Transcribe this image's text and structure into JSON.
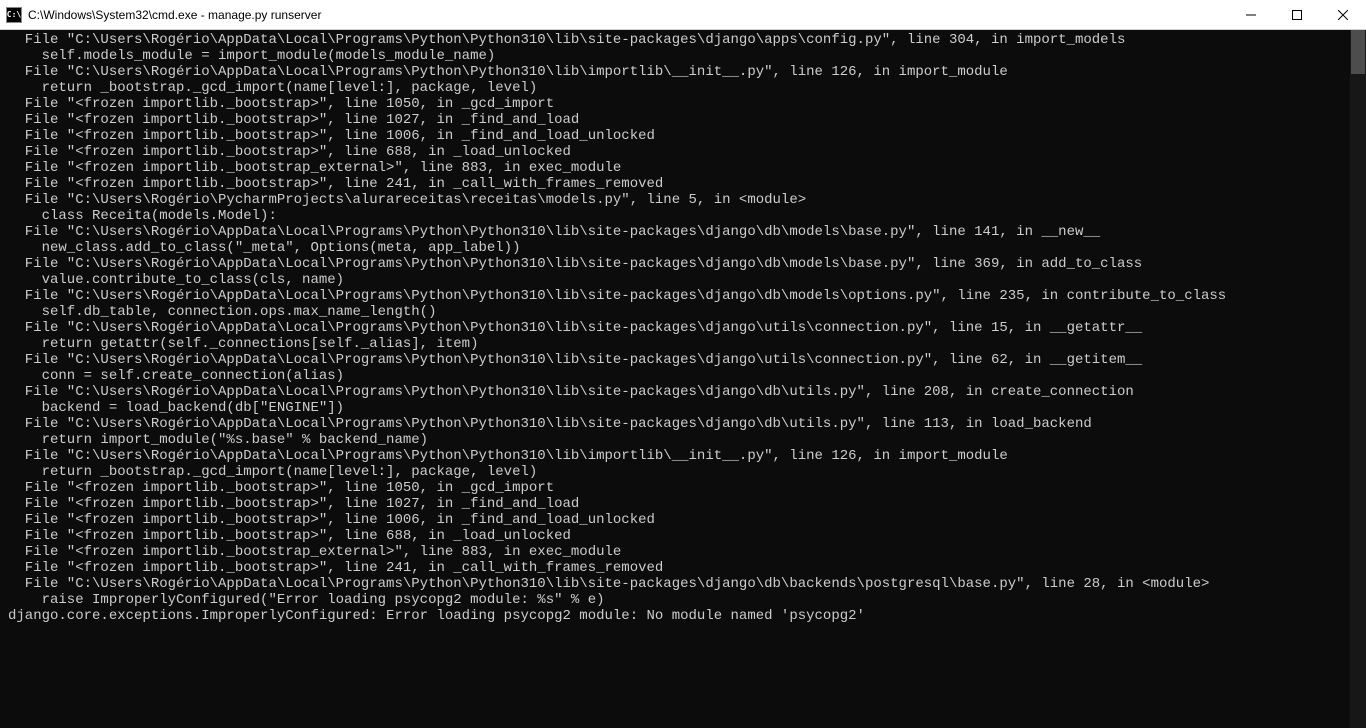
{
  "window": {
    "title": "C:\\Windows\\System32\\cmd.exe - manage.py  runserver",
    "icon_label": "C:\\"
  },
  "terminal": {
    "lines": [
      "  File \"C:\\Users\\Rogério\\AppData\\Local\\Programs\\Python\\Python310\\lib\\site-packages\\django\\apps\\config.py\", line 304, in import_models",
      "    self.models_module = import_module(models_module_name)",
      "  File \"C:\\Users\\Rogério\\AppData\\Local\\Programs\\Python\\Python310\\lib\\importlib\\__init__.py\", line 126, in import_module",
      "    return _bootstrap._gcd_import(name[level:], package, level)",
      "  File \"<frozen importlib._bootstrap>\", line 1050, in _gcd_import",
      "  File \"<frozen importlib._bootstrap>\", line 1027, in _find_and_load",
      "  File \"<frozen importlib._bootstrap>\", line 1006, in _find_and_load_unlocked",
      "  File \"<frozen importlib._bootstrap>\", line 688, in _load_unlocked",
      "  File \"<frozen importlib._bootstrap_external>\", line 883, in exec_module",
      "  File \"<frozen importlib._bootstrap>\", line 241, in _call_with_frames_removed",
      "  File \"C:\\Users\\Rogério\\PycharmProjects\\alurareceitas\\receitas\\models.py\", line 5, in <module>",
      "    class Receita(models.Model):",
      "  File \"C:\\Users\\Rogério\\AppData\\Local\\Programs\\Python\\Python310\\lib\\site-packages\\django\\db\\models\\base.py\", line 141, in __new__",
      "    new_class.add_to_class(\"_meta\", Options(meta, app_label))",
      "  File \"C:\\Users\\Rogério\\AppData\\Local\\Programs\\Python\\Python310\\lib\\site-packages\\django\\db\\models\\base.py\", line 369, in add_to_class",
      "    value.contribute_to_class(cls, name)",
      "  File \"C:\\Users\\Rogério\\AppData\\Local\\Programs\\Python\\Python310\\lib\\site-packages\\django\\db\\models\\options.py\", line 235, in contribute_to_class",
      "    self.db_table, connection.ops.max_name_length()",
      "  File \"C:\\Users\\Rogério\\AppData\\Local\\Programs\\Python\\Python310\\lib\\site-packages\\django\\utils\\connection.py\", line 15, in __getattr__",
      "    return getattr(self._connections[self._alias], item)",
      "  File \"C:\\Users\\Rogério\\AppData\\Local\\Programs\\Python\\Python310\\lib\\site-packages\\django\\utils\\connection.py\", line 62, in __getitem__",
      "    conn = self.create_connection(alias)",
      "  File \"C:\\Users\\Rogério\\AppData\\Local\\Programs\\Python\\Python310\\lib\\site-packages\\django\\db\\utils.py\", line 208, in create_connection",
      "    backend = load_backend(db[\"ENGINE\"])",
      "  File \"C:\\Users\\Rogério\\AppData\\Local\\Programs\\Python\\Python310\\lib\\site-packages\\django\\db\\utils.py\", line 113, in load_backend",
      "    return import_module(\"%s.base\" % backend_name)",
      "  File \"C:\\Users\\Rogério\\AppData\\Local\\Programs\\Python\\Python310\\lib\\importlib\\__init__.py\", line 126, in import_module",
      "    return _bootstrap._gcd_import(name[level:], package, level)",
      "  File \"<frozen importlib._bootstrap>\", line 1050, in _gcd_import",
      "  File \"<frozen importlib._bootstrap>\", line 1027, in _find_and_load",
      "  File \"<frozen importlib._bootstrap>\", line 1006, in _find_and_load_unlocked",
      "  File \"<frozen importlib._bootstrap>\", line 688, in _load_unlocked",
      "  File \"<frozen importlib._bootstrap_external>\", line 883, in exec_module",
      "  File \"<frozen importlib._bootstrap>\", line 241, in _call_with_frames_removed",
      "  File \"C:\\Users\\Rogério\\AppData\\Local\\Programs\\Python\\Python310\\lib\\site-packages\\django\\db\\backends\\postgresql\\base.py\", line 28, in <module>",
      "    raise ImproperlyConfigured(\"Error loading psycopg2 module: %s\" % e)",
      "django.core.exceptions.ImproperlyConfigured: Error loading psycopg2 module: No module named 'psycopg2'",
      ""
    ]
  }
}
